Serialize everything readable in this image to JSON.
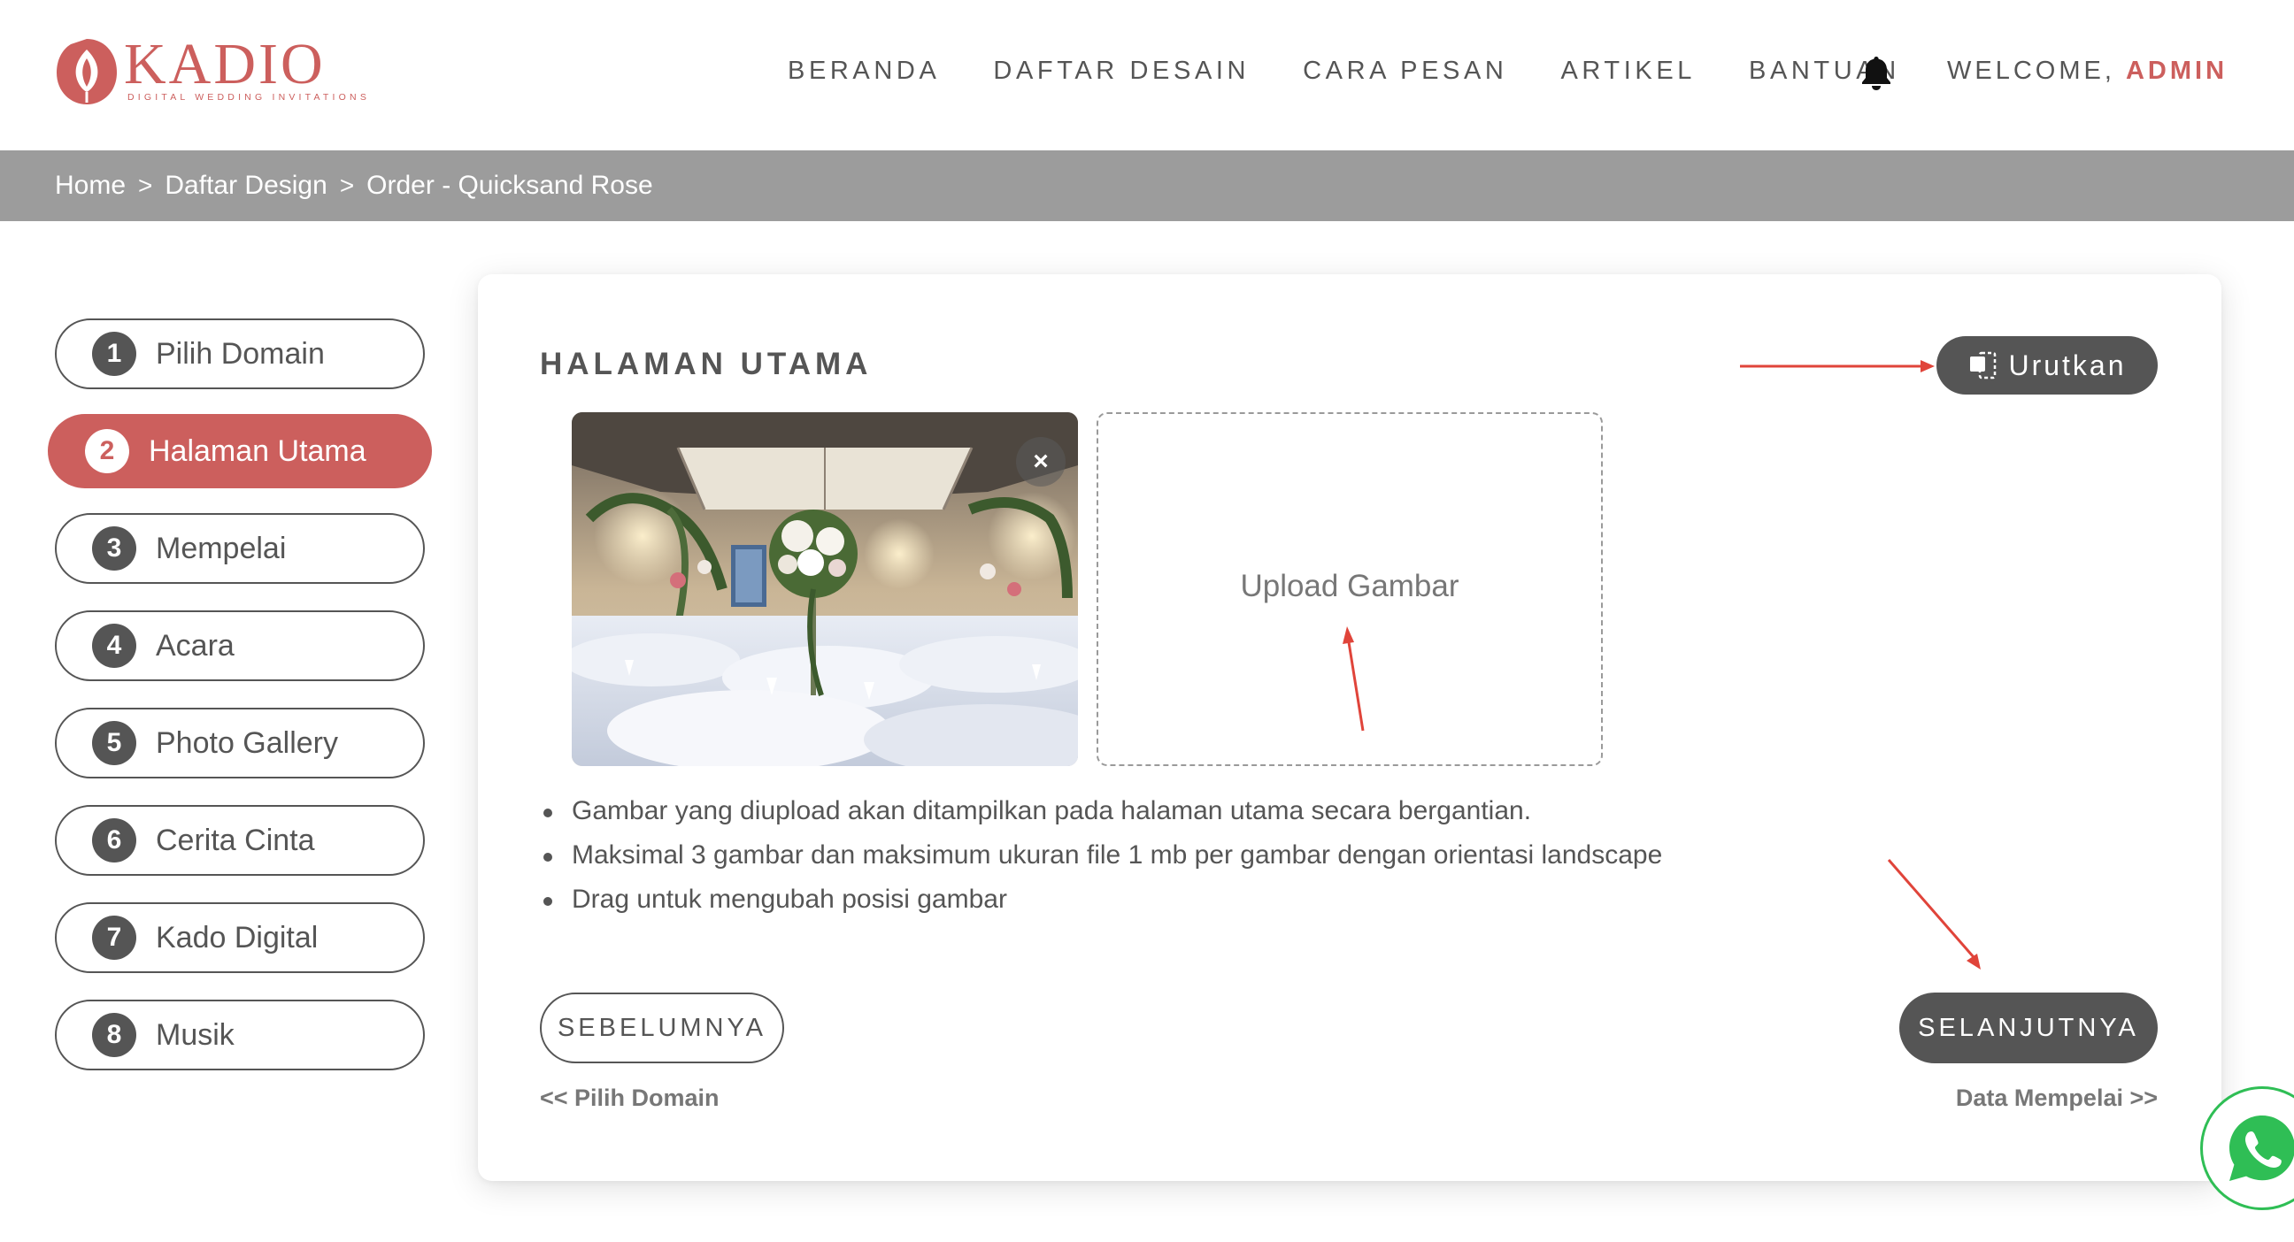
{
  "brand": {
    "name": "KADIO",
    "tagline": "DIGITAL WEDDING INVITATIONS",
    "color": "#cc5f5d"
  },
  "nav": {
    "items": [
      "BERANDA",
      "DAFTAR DESAIN",
      "CARA PESAN",
      "ARTIKEL",
      "BANTUAN"
    ],
    "notification_icon": "bell-icon",
    "welcome_label": "WELCOME,",
    "user": "ADMIN"
  },
  "breadcrumb": {
    "items": [
      "Home",
      "Daftar Design"
    ],
    "separator": ">",
    "current": "Order - Quicksand Rose"
  },
  "steps": [
    {
      "number": "1",
      "label": "Pilih Domain",
      "active": false
    },
    {
      "number": "2",
      "label": "Halaman Utama",
      "active": true
    },
    {
      "number": "3",
      "label": "Mempelai",
      "active": false
    },
    {
      "number": "4",
      "label": "Acara",
      "active": false
    },
    {
      "number": "5",
      "label": "Photo Gallery",
      "active": false
    },
    {
      "number": "6",
      "label": "Cerita Cinta",
      "active": false
    },
    {
      "number": "7",
      "label": "Kado Digital",
      "active": false
    },
    {
      "number": "8",
      "label": "Musik",
      "active": false
    }
  ],
  "panel": {
    "title": "HALAMAN UTAMA",
    "sort_button": "Urutkan",
    "sort_icon": "sort-icon",
    "image_remove": "×",
    "upload_label": "Upload Gambar",
    "notes": [
      "Gambar yang diupload akan ditampilkan pada halaman utama secara bergantian.",
      "Maksimal 3 gambar dan maksimum ukuran file 1 mb per gambar dengan orientasi landscape",
      "Drag untuk mengubah posisi gambar"
    ],
    "prev_button": "SEBELUMNYA",
    "next_button": "SELANJUTNYA",
    "prev_hint": "<< Pilih Domain",
    "next_hint": "Data Mempelai >>"
  },
  "colors": {
    "accent": "#cc5f5d",
    "dark": "#555555",
    "breadcrumb_bg": "#9c9c9c",
    "annotation_arrow": "#e0443a",
    "whatsapp": "#2fbe55"
  },
  "floating": {
    "whatsapp_icon": "whatsapp-icon"
  }
}
